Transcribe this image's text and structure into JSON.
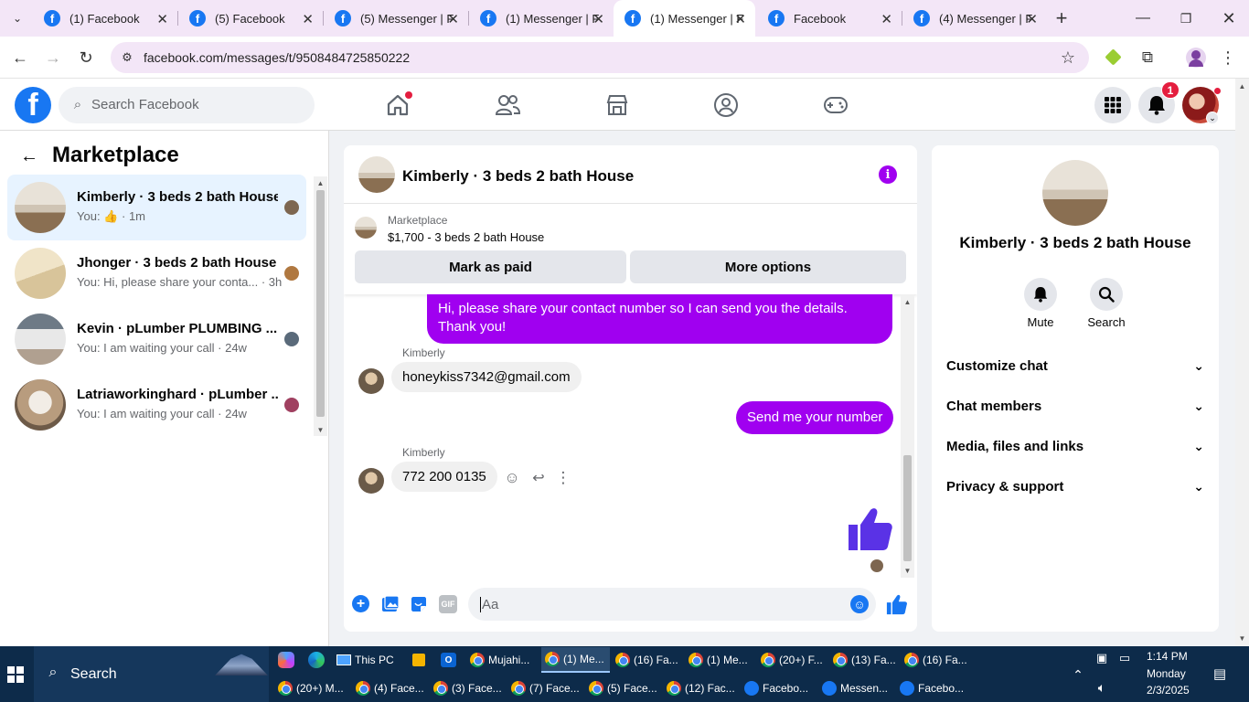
{
  "browser": {
    "tabs": [
      {
        "label": "(1) Facebook"
      },
      {
        "label": "(5) Facebook"
      },
      {
        "label": "(5) Messenger | F"
      },
      {
        "label": "(1) Messenger | F"
      },
      {
        "label": "(1) Messenger | F"
      },
      {
        "label": "Facebook"
      },
      {
        "label": "(4) Messenger | F"
      }
    ],
    "url": "facebook.com/messages/t/9508484725850222"
  },
  "fb": {
    "search_placeholder": "Search Facebook",
    "notif_count": "1"
  },
  "sidebar": {
    "title": "Marketplace",
    "conversations": [
      {
        "name": "Kimberly · 3 beds 2 bath House",
        "preview_prefix": "You:",
        "preview_suffix": "· 1m"
      },
      {
        "name": "Jhonger · 3 beds 2 bath House",
        "preview": "You: Hi, please share your conta... · 3h"
      },
      {
        "name": "Kevin · pLumber PLUMBING ...",
        "preview": "You: I am waiting your call · 24w"
      },
      {
        "name": "Latriaworkinghard · pLumber ...",
        "preview": "You: I am waiting your call · 24w"
      }
    ]
  },
  "chat": {
    "title": "Kimberly · 3 beds 2 bath House",
    "listing_source": "Marketplace",
    "listing_info": "$1,700 - 3 beds 2 bath House",
    "mark_paid_label": "Mark as paid",
    "more_options_label": "More options",
    "messages": [
      {
        "from": "me",
        "text": "Hi, please share your contact number so I can send you the details. Thank you!"
      },
      {
        "from": "them",
        "sender": "Kimberly",
        "text": "honeykiss7342@gmail.com"
      },
      {
        "from": "me",
        "text": "Send me your number"
      },
      {
        "from": "them",
        "sender": "Kimberly",
        "text": "772 200 0135"
      }
    ],
    "composer_placeholder": "Aa"
  },
  "details": {
    "name": "Kimberly · 3 beds 2 bath House",
    "mute_label": "Mute",
    "search_label": "Search",
    "sections": [
      {
        "label": "Customize chat"
      },
      {
        "label": "Chat members"
      },
      {
        "label": "Media, files and links"
      },
      {
        "label": "Privacy & support"
      }
    ]
  },
  "taskbar": {
    "search_label": "Search",
    "row1": [
      "This PC",
      "Mujahi...",
      "(1) Me...",
      "(16) Fa...",
      "(1) Me...",
      "(20+) F...",
      "(13) Fa...",
      "(16) Fa..."
    ],
    "row2": [
      "(20+) M...",
      "(4) Face...",
      "(3) Face...",
      "(7) Face...",
      "(5) Face...",
      "(12) Fac...",
      "Facebo...",
      "Messen...",
      "Facebo..."
    ],
    "time": "1:14 PM",
    "day": "Monday",
    "date": "2/3/2025"
  },
  "colors": {
    "fb_blue": "#1877f2",
    "messenger_purple": "#a000f0",
    "thumb": "#5a32e6"
  }
}
